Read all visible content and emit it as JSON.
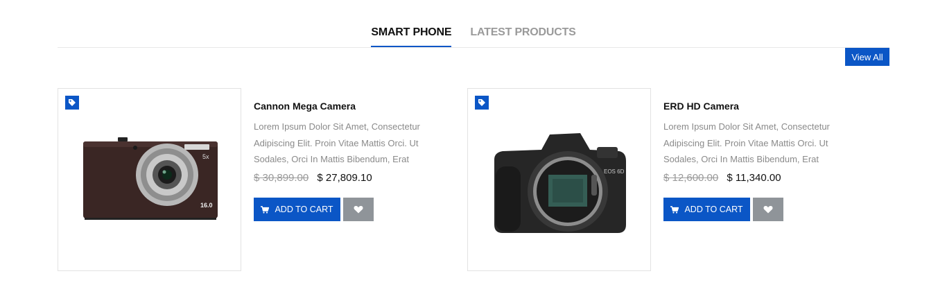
{
  "tabs": [
    {
      "label": "SMART PHONE",
      "active": true
    },
    {
      "label": "LATEST PRODUCTS",
      "active": false
    }
  ],
  "view_all_label": "View All",
  "products": [
    {
      "title": "Cannon Mega Camera",
      "description": "Lorem Ipsum Dolor Sit Amet, Consectetur Adipiscing Elit. Proin Vitae Mattis Orci. Ut Sodales, Orci In Mattis Bibendum, Erat",
      "old_price": "$ 30,899.00",
      "new_price": "$ 27,809.10",
      "add_to_cart_label": "ADD TO CART",
      "image": "compact-camera-image",
      "camera_text": {
        "zoom": "5x",
        "resolution": "16.0"
      }
    },
    {
      "title": "ERD HD Camera",
      "description": "Lorem Ipsum Dolor Sit Amet, Consectetur Adipiscing Elit. Proin Vitae Mattis Orci. Ut Sodales, Orci In Mattis Bibendum, Erat",
      "old_price": "$ 12,600.00",
      "new_price": "$ 11,340.00",
      "add_to_cart_label": "ADD TO CART",
      "image": "dslr-camera-image",
      "camera_text": {
        "model": "EOS 6D"
      }
    }
  ],
  "colors": {
    "accent": "#0b56c6",
    "wishlist": "#8f9499",
    "muted_text": "#8a8a8a"
  },
  "icons": [
    "tag-icon",
    "cart-icon",
    "heart-icon"
  ]
}
